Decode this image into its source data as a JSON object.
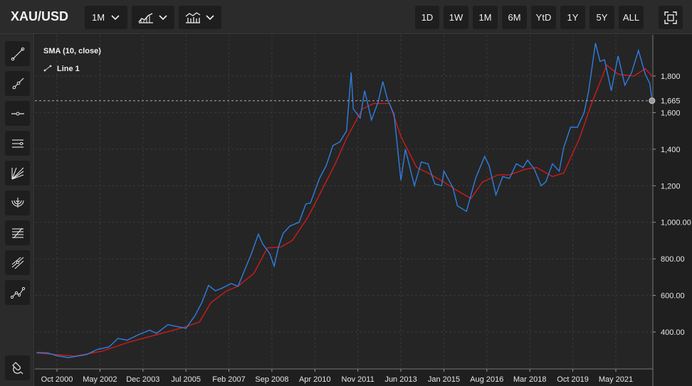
{
  "toolbar": {
    "symbol": "XAU/USD",
    "interval_label": "1M",
    "ranges": [
      "1D",
      "1W",
      "1M",
      "6M",
      "YtD",
      "1Y",
      "5Y",
      "ALL"
    ]
  },
  "left_tools": [
    "trend-line-icon",
    "ray-icon",
    "horizontal-line-icon",
    "parallel-channel-icon",
    "fib-fan-icon",
    "fib-arc-icon",
    "fib-retracement-icon",
    "pitchfork-icon",
    "multi-point-line-icon",
    "magnet-icon"
  ],
  "chart_data": {
    "type": "line",
    "title": "",
    "legend": [
      "SMA (10, close)",
      "Line 1"
    ],
    "x_ticks": [
      "Oct 2000",
      "May 2002",
      "Dec 2003",
      "Jul 2005",
      "Feb 2007",
      "Sep 2008",
      "Apr 2010",
      "Nov 2011",
      "Jun 2013",
      "Jan 2015",
      "Aug 2016",
      "Mar 2018",
      "Oct 2019",
      "May 2021"
    ],
    "y_ticks": [
      400,
      600,
      800,
      "1,000.00",
      1200,
      1400,
      1600,
      1800
    ],
    "y_tick_labels": [
      "400.00",
      "600.00",
      "800.00",
      "1,000.00",
      "1,200",
      "1,400",
      "1,600",
      "1,800"
    ],
    "ylim": [
      200,
      2000
    ],
    "last_price_label": "1,665",
    "last_price": 1665,
    "colors": {
      "price": "#2f7fe0",
      "sma": "#d11a1a",
      "background": "#252525",
      "grid": "#3a3a3a"
    },
    "price_series": {
      "name": "Line 1",
      "points": [
        [
          "2000-01",
          288
        ],
        [
          "2000-06",
          285
        ],
        [
          "2000-10",
          270
        ],
        [
          "2001-03",
          260
        ],
        [
          "2001-07",
          268
        ],
        [
          "2001-11",
          276
        ],
        [
          "2002-04",
          305
        ],
        [
          "2002-09",
          318
        ],
        [
          "2003-01",
          365
        ],
        [
          "2003-05",
          355
        ],
        [
          "2003-10",
          385
        ],
        [
          "2004-03",
          410
        ],
        [
          "2004-06",
          392
        ],
        [
          "2004-11",
          440
        ],
        [
          "2005-03",
          430
        ],
        [
          "2005-07",
          420
        ],
        [
          "2005-11",
          490
        ],
        [
          "2006-02",
          560
        ],
        [
          "2006-05",
          655
        ],
        [
          "2006-08",
          625
        ],
        [
          "2006-11",
          640
        ],
        [
          "2007-03",
          665
        ],
        [
          "2007-06",
          650
        ],
        [
          "2007-09",
          740
        ],
        [
          "2007-12",
          830
        ],
        [
          "2008-03",
          935
        ],
        [
          "2008-05",
          880
        ],
        [
          "2008-08",
          830
        ],
        [
          "2008-10",
          760
        ],
        [
          "2008-12",
          870
        ],
        [
          "2009-02",
          940
        ],
        [
          "2009-05",
          980
        ],
        [
          "2009-09",
          1000
        ],
        [
          "2009-12",
          1100
        ],
        [
          "2010-02",
          1105
        ],
        [
          "2010-06",
          1240
        ],
        [
          "2010-09",
          1310
        ],
        [
          "2010-12",
          1420
        ],
        [
          "2011-03",
          1440
        ],
        [
          "2011-06",
          1500
        ],
        [
          "2011-08",
          1820
        ],
        [
          "2011-09",
          1620
        ],
        [
          "2011-12",
          1570
        ],
        [
          "2012-02",
          1720
        ],
        [
          "2012-05",
          1560
        ],
        [
          "2012-08",
          1660
        ],
        [
          "2012-10",
          1770
        ],
        [
          "2012-12",
          1675
        ],
        [
          "2013-03",
          1590
        ],
        [
          "2013-04",
          1470
        ],
        [
          "2013-06",
          1230
        ],
        [
          "2013-08",
          1400
        ],
        [
          "2013-12",
          1200
        ],
        [
          "2014-03",
          1330
        ],
        [
          "2014-06",
          1320
        ],
        [
          "2014-09",
          1210
        ],
        [
          "2014-12",
          1200
        ],
        [
          "2015-01",
          1280
        ],
        [
          "2015-05",
          1190
        ],
        [
          "2015-07",
          1090
        ],
        [
          "2015-11",
          1060
        ],
        [
          "2016-03",
          1240
        ],
        [
          "2016-07",
          1360
        ],
        [
          "2016-09",
          1310
        ],
        [
          "2016-12",
          1150
        ],
        [
          "2017-03",
          1250
        ],
        [
          "2017-06",
          1240
        ],
        [
          "2017-09",
          1320
        ],
        [
          "2017-12",
          1300
        ],
        [
          "2018-02",
          1340
        ],
        [
          "2018-05",
          1290
        ],
        [
          "2018-08",
          1200
        ],
        [
          "2018-10",
          1220
        ],
        [
          "2019-01",
          1320
        ],
        [
          "2019-04",
          1280
        ],
        [
          "2019-06",
          1410
        ],
        [
          "2019-09",
          1520
        ],
        [
          "2019-12",
          1520
        ],
        [
          "2020-03",
          1600
        ],
        [
          "2020-05",
          1720
        ],
        [
          "2020-08",
          1980
        ],
        [
          "2020-10",
          1880
        ],
        [
          "2020-12",
          1890
        ],
        [
          "2021-03",
          1720
        ],
        [
          "2021-06",
          1910
        ],
        [
          "2021-09",
          1750
        ],
        [
          "2021-12",
          1820
        ],
        [
          "2022-03",
          1940
        ],
        [
          "2022-06",
          1810
        ],
        [
          "2022-08",
          1760
        ],
        [
          "2022-09",
          1665
        ]
      ]
    },
    "sma_series": {
      "name": "SMA (10, close)",
      "points": [
        [
          "2000-01",
          285
        ],
        [
          "2001-06",
          268
        ],
        [
          "2002-06",
          295
        ],
        [
          "2003-06",
          345
        ],
        [
          "2004-06",
          385
        ],
        [
          "2005-06",
          425
        ],
        [
          "2006-01",
          455
        ],
        [
          "2006-06",
          560
        ],
        [
          "2007-01",
          625
        ],
        [
          "2007-06",
          650
        ],
        [
          "2008-01",
          720
        ],
        [
          "2008-07",
          860
        ],
        [
          "2009-01",
          865
        ],
        [
          "2009-06",
          900
        ],
        [
          "2010-01",
          1030
        ],
        [
          "2010-06",
          1150
        ],
        [
          "2011-01",
          1320
        ],
        [
          "2011-06",
          1460
        ],
        [
          "2012-01",
          1620
        ],
        [
          "2012-06",
          1650
        ],
        [
          "2013-01",
          1650
        ],
        [
          "2013-06",
          1470
        ],
        [
          "2014-01",
          1300
        ],
        [
          "2014-06",
          1270
        ],
        [
          "2015-01",
          1220
        ],
        [
          "2015-06",
          1180
        ],
        [
          "2016-01",
          1130
        ],
        [
          "2016-06",
          1220
        ],
        [
          "2017-01",
          1260
        ],
        [
          "2017-06",
          1260
        ],
        [
          "2018-01",
          1290
        ],
        [
          "2018-06",
          1300
        ],
        [
          "2019-01",
          1250
        ],
        [
          "2019-06",
          1270
        ],
        [
          "2020-01",
          1460
        ],
        [
          "2020-06",
          1640
        ],
        [
          "2021-01",
          1860
        ],
        [
          "2021-06",
          1810
        ],
        [
          "2022-01",
          1800
        ],
        [
          "2022-06",
          1840
        ],
        [
          "2022-09",
          1800
        ]
      ]
    }
  }
}
